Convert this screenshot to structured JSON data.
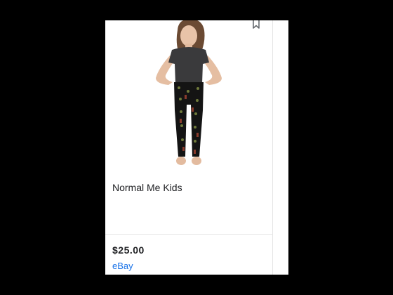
{
  "product": {
    "image_alt": "Girl wearing black leggings",
    "title": "Normal Me Kids",
    "price": "$25.00",
    "seller": "eBay"
  },
  "icons": {
    "save": "bookmark-icon"
  },
  "colors": {
    "page_background": "#000000",
    "card_background": "#ffffff",
    "title_text": "#202124",
    "seller_link": "#1a73e8"
  }
}
